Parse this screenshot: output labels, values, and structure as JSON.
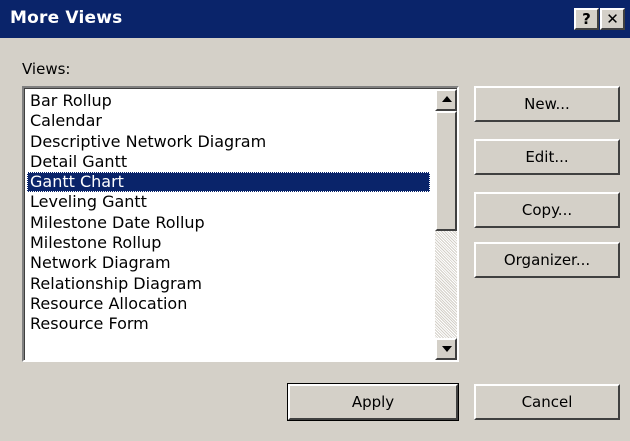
{
  "window": {
    "title": "More Views",
    "help_label": "?",
    "close_label": "✕"
  },
  "views": {
    "label": "Views:",
    "items": [
      "Bar Rollup",
      "Calendar",
      "Descriptive Network Diagram",
      "Detail Gantt",
      "Gantt Chart",
      "Leveling Gantt",
      "Milestone Date Rollup",
      "Milestone Rollup",
      "Network Diagram",
      "Relationship Diagram",
      "Resource Allocation",
      "Resource Form"
    ],
    "selected": "Gantt Chart"
  },
  "buttons": {
    "new": "New...",
    "edit": "Edit...",
    "copy": "Copy...",
    "organizer": "Organizer...",
    "apply": "Apply",
    "cancel": "Cancel"
  },
  "colors": {
    "titlebar": "#0a246a",
    "face": "#d4d0c8",
    "selection": "#0a246a"
  }
}
